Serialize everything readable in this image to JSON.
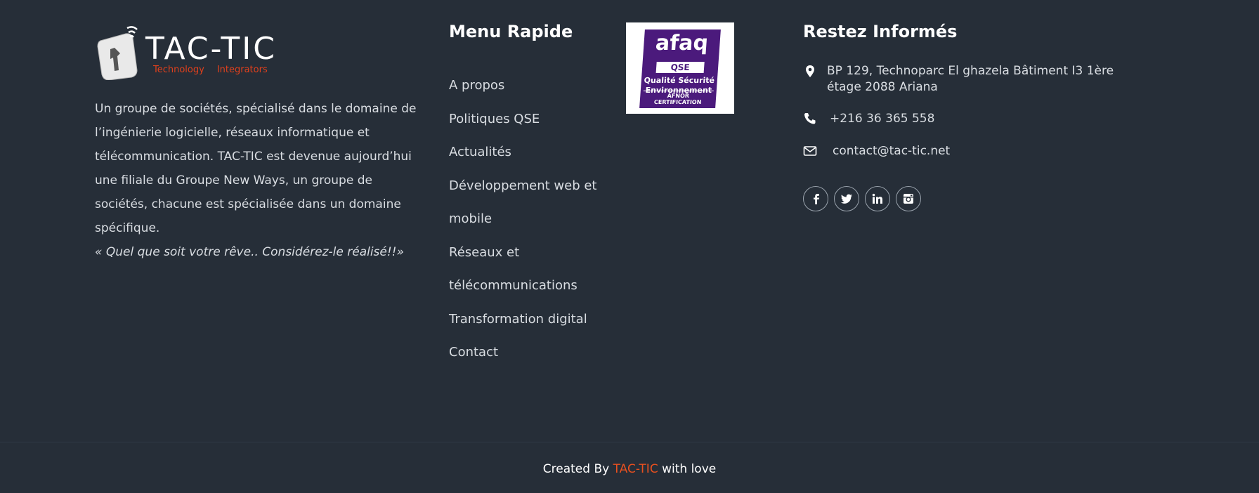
{
  "brand": {
    "logo_word": "TAC-TIC",
    "logo_sub_1": "Technology",
    "logo_sub_2": "Integrators",
    "description": "Un groupe de sociétés, spécialisé dans le domaine de l’ingénierie logicielle, réseaux informatique et télécommunication. TAC-TIC est devenue aujourd’hui une filiale du Groupe New Ways, un groupe de sociétés, chacune est spécialisée dans un domaine spécifique.",
    "quote": "« Quel que soit votre rêve.. Considérez-le réalisé!!»"
  },
  "menu": {
    "title": "Menu Rapide",
    "items": [
      {
        "label": "A propos"
      },
      {
        "label": "Politiques QSE"
      },
      {
        "label": "Actualités"
      },
      {
        "label": "Développement web et mobile"
      },
      {
        "label": "Réseaux et télécommunications"
      },
      {
        "label": "Transformation digital"
      },
      {
        "label": "Contact"
      }
    ]
  },
  "afaq": {
    "title": "afaq",
    "qse": "QSE",
    "line1": "Qualité Sécurité",
    "line2": "Environnement",
    "cert": "AFNOR CERTIFICATION"
  },
  "contact": {
    "title": "Restez Informés",
    "address": "BP 129, Technoparc El ghazela Bâtiment I3 1ère étage 2088 Ariana",
    "phone": "+216 36 365 558",
    "email": "contact@tac-tic.net",
    "icons": [
      "map-marker-icon",
      "phone-icon",
      "envelope-icon"
    ],
    "socials": [
      "facebook",
      "twitter",
      "linkedin",
      "instagram"
    ]
  },
  "footer": {
    "credit_prefix": "Created By",
    "credit_brand": "TAC-TIC",
    "credit_suffix": "with love"
  },
  "colors": {
    "background": "#262e38",
    "accent": "#e8501f",
    "afaq_purple": "#4b1a7c"
  }
}
